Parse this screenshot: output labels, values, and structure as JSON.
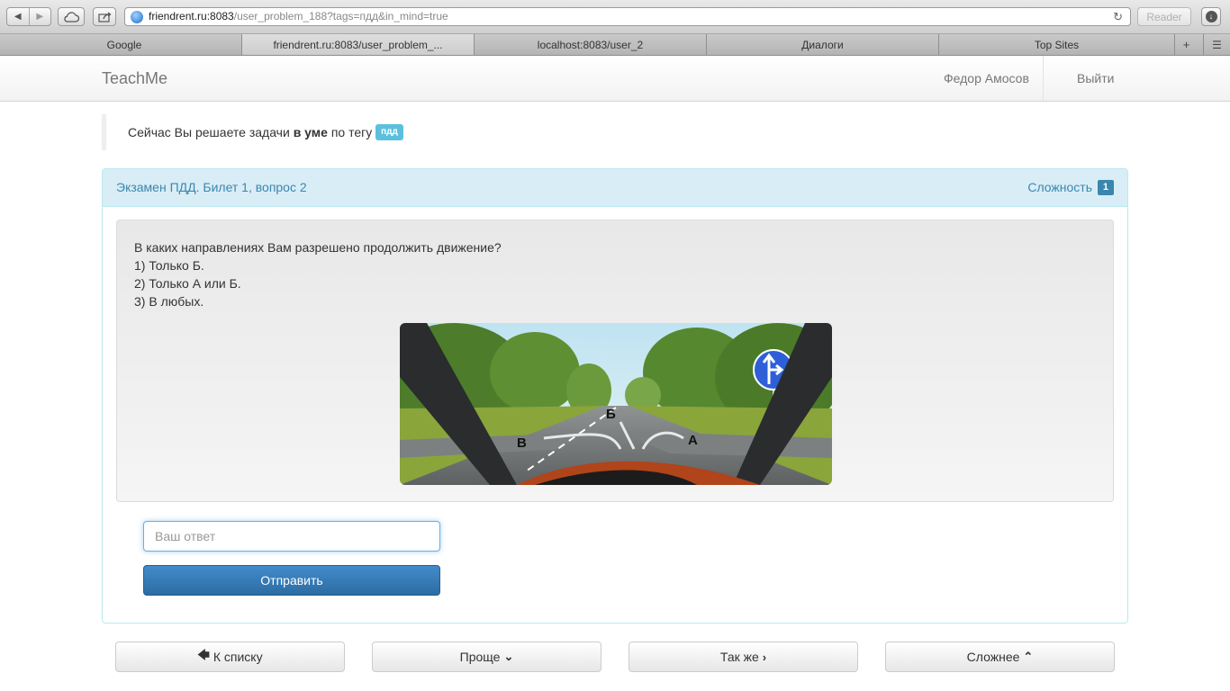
{
  "browser": {
    "url_host": "friendrent.ru:8083",
    "url_path": "/user_problem_188?tags=пдд&in_mind=true",
    "reader_label": "Reader",
    "tabs": [
      {
        "label": "Google"
      },
      {
        "label": "friendrent.ru:8083/user_problem_..."
      },
      {
        "label": "localhost:8083/user_2"
      },
      {
        "label": "Диалоги"
      },
      {
        "label": "Top Sites"
      }
    ]
  },
  "navbar": {
    "brand": "TeachMe",
    "user_name": "Федор Амосов",
    "logout": "Выйти"
  },
  "info": {
    "prefix": "Сейчас Вы решаете задачи",
    "mode": "в уме",
    "middle": "по тегу",
    "tag": "пдд"
  },
  "problem": {
    "title": "Экзамен ПДД. Билет 1, вопрос 2",
    "difficulty_label": "Сложность",
    "difficulty_value": "1",
    "question": "В каких направлениях Вам разрешено продолжить движение?",
    "options": [
      "1) Только Б.",
      "2) Только А или Б.",
      "3) В любых."
    ],
    "image_labels": {
      "a": "А",
      "b": "Б",
      "v": "В"
    }
  },
  "answer": {
    "placeholder": "Ваш ответ",
    "submit": "Отправить"
  },
  "footer_buttons": {
    "to_list": "К списку",
    "easier": "Проще",
    "same": "Так же",
    "harder": "Сложнее"
  }
}
